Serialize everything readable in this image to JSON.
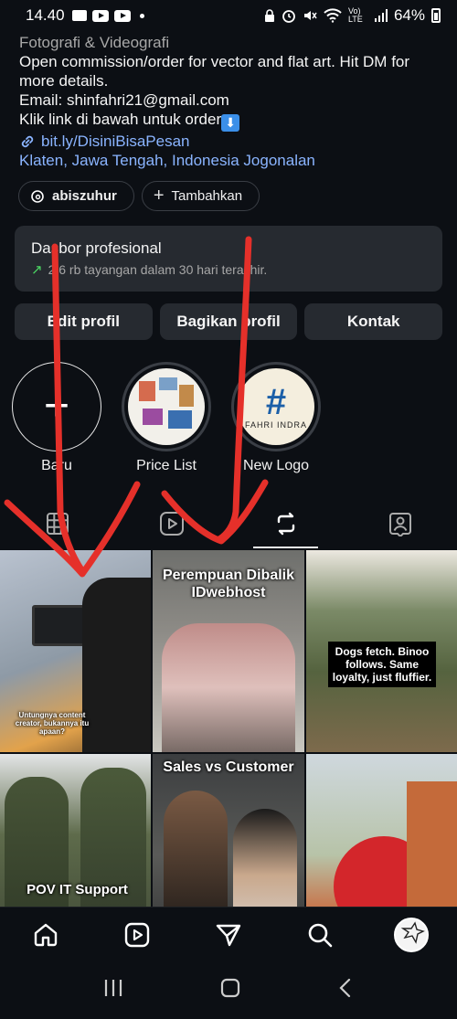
{
  "status_bar": {
    "time": "14.40",
    "battery": "64%",
    "network": "Vo) LTE"
  },
  "bio": {
    "category": "Fotografi & Videografi",
    "line1": "Open commission/order for vector and flat art. Hit DM for more details.",
    "email": "Email: shinfahri21@gmail.com",
    "order": "Klik link di bawah untuk order",
    "link": "bit.ly/DisiniBisaPesan",
    "location": "Klaten, Jawa Tengah, Indonesia Jogonalan"
  },
  "chips": {
    "threads_handle": "abiszuhur",
    "add_label": "Tambahkan"
  },
  "dashboard": {
    "title": "Dasbor profesional",
    "subtitle": "2,6 rb tayangan dalam 30 hari terakhir."
  },
  "actions": {
    "edit": "Edit profil",
    "share": "Bagikan profil",
    "contact": "Kontak"
  },
  "highlights": [
    {
      "label": "Baru"
    },
    {
      "label": "Price List"
    },
    {
      "label": "New Logo"
    }
  ],
  "highlight_text": {
    "logo_name": "FAHRI INDRA"
  },
  "grid": {
    "post1_caption": "Untungnya content creator, bukannya itu apaan?",
    "post2_title": "Perempuan Dibalik IDwebhost",
    "post3_caption": "Dogs fetch. Binoo follows. Same loyalty, just fluffier.",
    "post4_title": "POV IT Support",
    "post5_title": "Sales vs Customer"
  },
  "colors": {
    "background": "#0c0f14",
    "card": "#262a30",
    "link": "#8ab4ff",
    "arrow_red": "#e5302a",
    "trend_green": "#4cd964"
  }
}
